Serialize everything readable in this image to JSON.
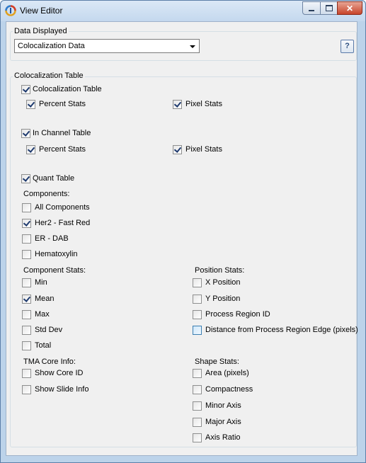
{
  "window": {
    "title": "View Editor"
  },
  "data_displayed": {
    "label": "Data Displayed",
    "selected": "Colocalization Data",
    "help_label": "?"
  },
  "colocalization_table": {
    "group_label": "Colocalization Table",
    "colocalization_table": {
      "label": "Colocalization Table",
      "checked": true
    },
    "coloc_percent_stats": {
      "label": "Percent Stats",
      "checked": true
    },
    "coloc_pixel_stats": {
      "label": "Pixel Stats",
      "checked": true
    },
    "in_channel_table": {
      "label": "In Channel Table",
      "checked": true
    },
    "inch_percent_stats": {
      "label": "Percent Stats",
      "checked": true
    },
    "inch_pixel_stats": {
      "label": "Pixel Stats",
      "checked": true
    },
    "quant_table": {
      "label": "Quant Table",
      "checked": true
    }
  },
  "components": {
    "header": "Components:",
    "items": [
      {
        "label": "All Components",
        "checked": false
      },
      {
        "label": "Her2 - Fast Red",
        "checked": true
      },
      {
        "label": "ER - DAB",
        "checked": false
      },
      {
        "label": "Hematoxylin",
        "checked": false
      }
    ]
  },
  "component_stats": {
    "header": "Component Stats:",
    "items": [
      {
        "label": "Min",
        "checked": false
      },
      {
        "label": "Mean",
        "checked": true
      },
      {
        "label": "Max",
        "checked": false
      },
      {
        "label": "Std Dev",
        "checked": false
      },
      {
        "label": "Total",
        "checked": false
      }
    ]
  },
  "position_stats": {
    "header": "Position Stats:",
    "items": [
      {
        "label": "X Position",
        "checked": false
      },
      {
        "label": "Y Position",
        "checked": false
      },
      {
        "label": "Process Region ID",
        "checked": false
      },
      {
        "label": "Distance from Process Region Edge (pixels)",
        "checked": false
      }
    ]
  },
  "tma_core_info": {
    "header": "TMA Core Info:",
    "items": [
      {
        "label": "Show Core ID",
        "checked": false
      },
      {
        "label": "Show Slide Info",
        "checked": false
      }
    ]
  },
  "shape_stats": {
    "header": "Shape Stats:",
    "items": [
      {
        "label": "Area (pixels)",
        "checked": false
      },
      {
        "label": "Compactness",
        "checked": false
      },
      {
        "label": "Minor Axis",
        "checked": false
      },
      {
        "label": "Major Axis",
        "checked": false
      },
      {
        "label": "Axis Ratio",
        "checked": false
      }
    ]
  }
}
